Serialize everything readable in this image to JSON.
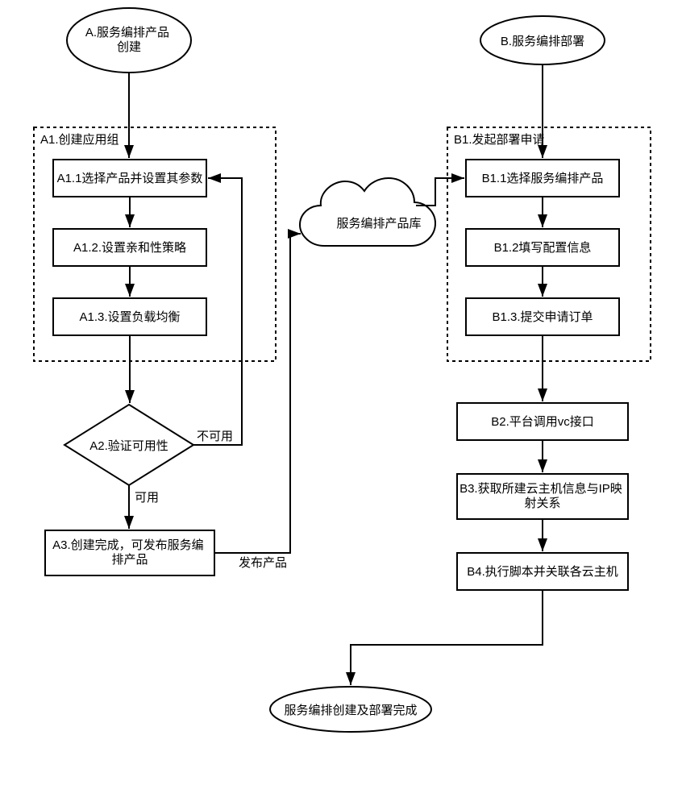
{
  "nodes": {
    "A": "A.服务编排产品\n创建",
    "B": "B.服务编排部署",
    "A1": "A1.创建应用组",
    "A11": "A1.1选择产品并设置其参数",
    "A12": "A1.2.设置亲和性策略",
    "A13": "A1.3.设置负载均衡",
    "A2": "A2.验证可用性",
    "A3": "A3.创建完成，可发布服务编\n排产品",
    "cloud": "服务编排产品库",
    "B1": "B1.发起部署申请",
    "B11": "B1.1选择服务编排产品",
    "B12": "B1.2填写配置信息",
    "B13": "B1.3.提交申请订单",
    "B2": "B2.平台调用vc接口",
    "B3": "B3.获取所建云主机信息与IP映\n射关系",
    "B4": "B4.执行脚本并关联各云主机",
    "end": "服务编排创建及部署完成",
    "lbl_unavail": "不可用",
    "lbl_avail": "可用",
    "lbl_publish": "发布产品"
  }
}
